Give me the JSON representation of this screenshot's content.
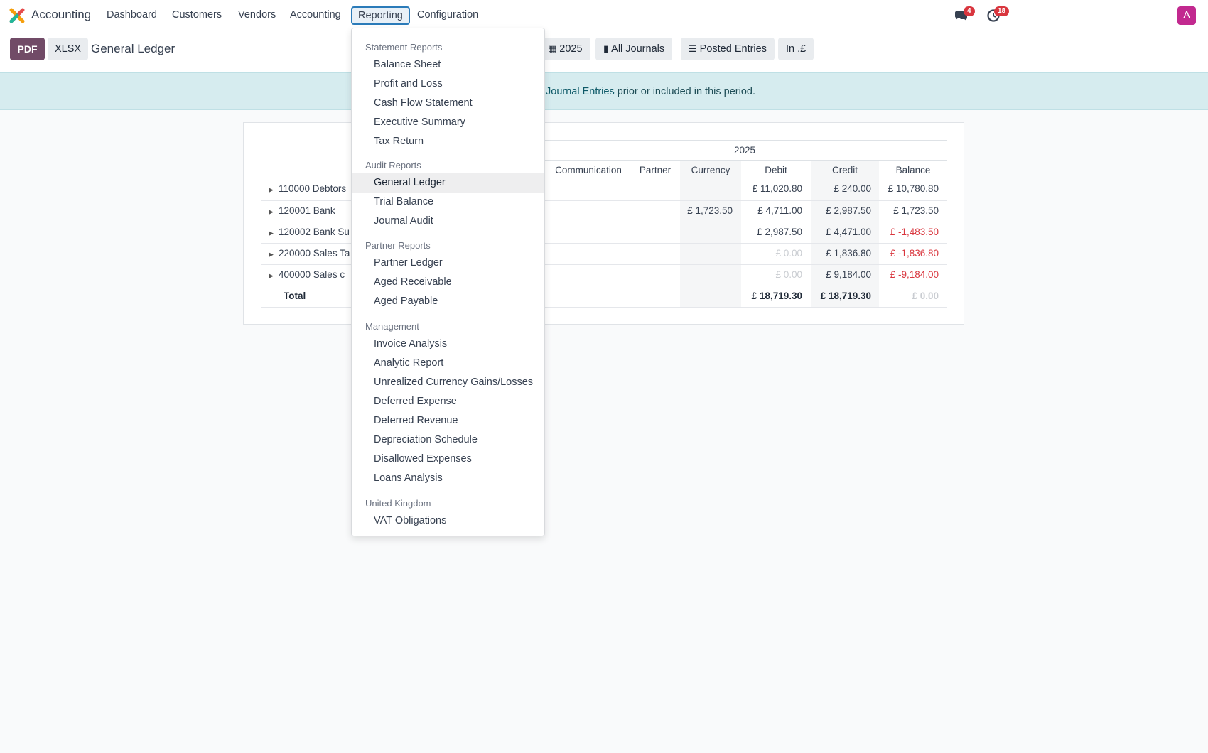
{
  "navbar": {
    "app_name": "Accounting",
    "items": [
      "Dashboard",
      "Customers",
      "Vendors",
      "Accounting",
      "Reporting",
      "Configuration"
    ],
    "active_item": "Reporting",
    "chat_badge": "4",
    "activity_badge": "18",
    "avatar_letter": "A",
    "brand_color": "#714b67"
  },
  "controls": {
    "pdf_label": "PDF",
    "xlsx_label": "XLSX",
    "page_title": "General Ledger",
    "filters": [
      "2025",
      "All Journals",
      "Posted Entries",
      "In .£"
    ],
    "filter_icons": [
      "calendar-icon",
      "book-icon",
      "sliders-icon",
      ""
    ]
  },
  "banner": {
    "link_text": "Journal Entries",
    "text_after": " prior or included in this period."
  },
  "report": {
    "period_header": "2025",
    "columns": [
      "Communication",
      "Partner",
      "Currency",
      "Debit",
      "Credit",
      "Balance"
    ],
    "rows": [
      {
        "account": "110000 Debtors",
        "currency": "",
        "debit": "£ 11,020.80",
        "credit": "£ 240.00",
        "balance": "£ 10,780.80"
      },
      {
        "account": "120001 Bank",
        "currency": "£ 1,723.50",
        "debit": "£ 4,711.00",
        "credit": "£ 2,987.50",
        "balance": "£ 1,723.50"
      },
      {
        "account": "120002 Bank Su",
        "currency": "",
        "debit": "£ 2,987.50",
        "credit": "£ 4,471.00",
        "balance": "£ -1,483.50"
      },
      {
        "account": "220000 Sales Ta",
        "currency": "",
        "debit": "£ 0.00",
        "credit": "£ 1,836.80",
        "balance": "£ -1,836.80"
      },
      {
        "account": "400000 Sales c",
        "currency": "",
        "debit": "£ 0.00",
        "credit": "£ 9,184.00",
        "balance": "£ -9,184.00"
      }
    ],
    "total": {
      "label": "Total",
      "debit": "£ 18,719.30",
      "credit": "£ 18,719.30",
      "balance": "£ 0.00"
    }
  },
  "dropdown": {
    "sections": [
      {
        "header": "Statement Reports",
        "items": [
          "Balance Sheet",
          "Profit and Loss",
          "Cash Flow Statement",
          "Executive Summary",
          "Tax Return"
        ]
      },
      {
        "header": "Audit Reports",
        "items": [
          "General Ledger",
          "Trial Balance",
          "Journal Audit"
        ]
      },
      {
        "header": "Partner Reports",
        "items": [
          "Partner Ledger",
          "Aged Receivable",
          "Aged Payable"
        ]
      },
      {
        "header": "Management",
        "items": [
          "Invoice Analysis",
          "Analytic Report",
          "Unrealized Currency Gains/Losses",
          "Deferred Expense",
          "Deferred Revenue",
          "Depreciation Schedule",
          "Disallowed Expenses",
          "Loans Analysis"
        ]
      },
      {
        "header": "United Kingdom",
        "items": [
          "VAT Obligations"
        ]
      }
    ],
    "active_item": "General Ledger"
  }
}
